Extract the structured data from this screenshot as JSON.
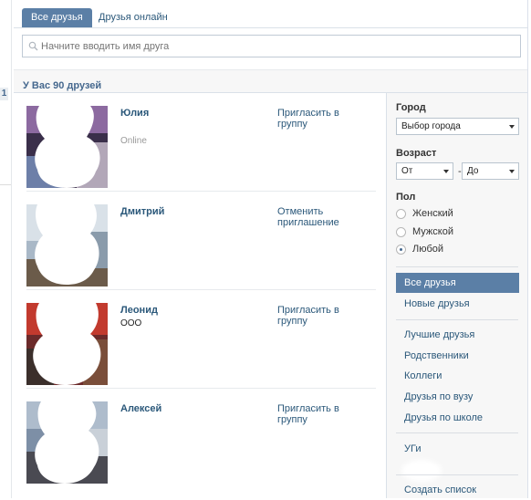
{
  "left": {
    "page_marker": "1"
  },
  "tabs": [
    {
      "label": "Все друзья"
    },
    {
      "label": "Друзья онлайн"
    }
  ],
  "search": {
    "placeholder": "Начните вводить имя друга"
  },
  "summary": {
    "count_text": "У Вас 90 друзей"
  },
  "friends": [
    {
      "name": "Юлия",
      "subtitle": "",
      "status": "Online",
      "action": "Пригласить в группу"
    },
    {
      "name": "Дмитрий",
      "subtitle": "",
      "status": "",
      "action": "Отменить приглашение"
    },
    {
      "name": "Леонид",
      "subtitle": "ООО",
      "status": "",
      "action": "Пригласить в группу"
    },
    {
      "name": "Алексей",
      "subtitle": "",
      "status": "",
      "action": "Пригласить в группу"
    }
  ],
  "filters": {
    "city_label": "Город",
    "city_value": "Выбор города",
    "age_label": "Возраст",
    "age_from": "От",
    "age_dash": "-",
    "age_to": "До",
    "gender_label": "Пол",
    "gender_options": [
      "Женский",
      "Мужской",
      "Любой"
    ],
    "gender_selected": "Любой"
  },
  "nav": {
    "primary": [
      "Все друзья",
      "Новые друзья"
    ],
    "lists": [
      "Лучшие друзья",
      "Родственники",
      "Коллеги",
      "Друзья по вузу",
      "Друзья по школе"
    ],
    "extra": [
      "УГи"
    ],
    "create": "Создать список"
  },
  "colors": {
    "accent": "#5b7fa6",
    "link": "#2b587a",
    "heading": "#45688e"
  }
}
